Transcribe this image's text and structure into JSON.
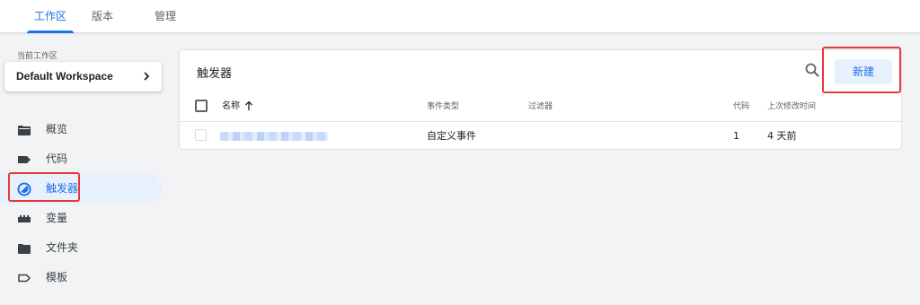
{
  "tabs": [
    {
      "label": "工作区",
      "active": true
    },
    {
      "label": "版本",
      "active": false
    },
    {
      "label": "管理",
      "active": false
    }
  ],
  "workspace": {
    "label": "当前工作区",
    "name": "Default Workspace"
  },
  "nav": {
    "items": [
      {
        "label": "概览",
        "icon": "folder-open-icon"
      },
      {
        "label": "代码",
        "icon": "tag-icon"
      },
      {
        "label": "触发器",
        "icon": "trigger-icon",
        "active": true
      },
      {
        "label": "变量",
        "icon": "variable-blocks-icon"
      },
      {
        "label": "文件夹",
        "icon": "folder-icon"
      },
      {
        "label": "模板",
        "icon": "tag-outline-icon"
      }
    ]
  },
  "main": {
    "title": "触发器",
    "new_button": "新建",
    "columns": {
      "name": "名称",
      "event_type": "事件类型",
      "filter": "过滤器",
      "code": "代码",
      "last_modified": "上次修改时间"
    },
    "rows": [
      {
        "event_type": "自定义事件",
        "filter": "",
        "code": "1",
        "last_modified": "4 天前"
      }
    ]
  },
  "colors": {
    "accent": "#1a73e8",
    "highlight_box": "#e53935",
    "active_bg": "#e8f0fe"
  }
}
